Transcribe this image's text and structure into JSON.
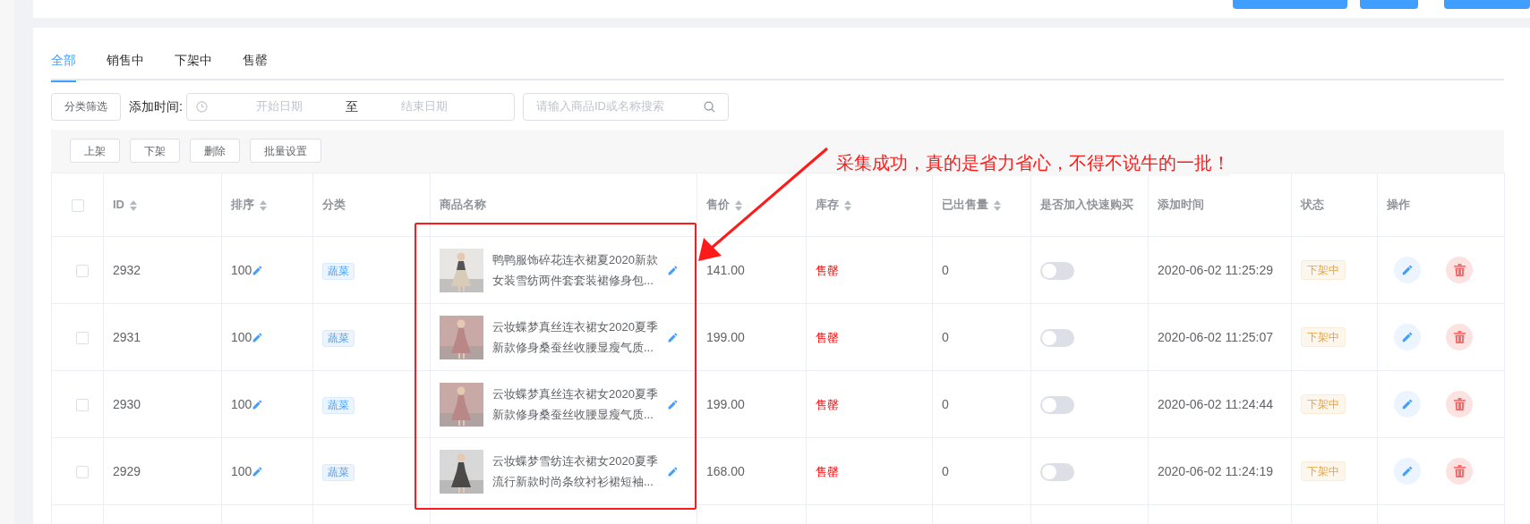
{
  "tabs": [
    {
      "label": "全部",
      "selected": true
    },
    {
      "label": "销售中",
      "selected": false
    },
    {
      "label": "下架中",
      "selected": false
    },
    {
      "label": "售罄",
      "selected": false
    }
  ],
  "filter": {
    "category_button": "分类筛选",
    "date_label": "添加时间:",
    "start_placeholder": "开始日期",
    "separator": "至",
    "end_placeholder": "结束日期",
    "search_placeholder": "请输入商品ID或名称搜索"
  },
  "toolbar": [
    "上架",
    "下架",
    "删除",
    "批量设置"
  ],
  "table": {
    "all_checked": false,
    "columns": [
      {
        "label": "ID",
        "sortable": true
      },
      {
        "label": "排序",
        "sortable": true
      },
      {
        "label": "分类",
        "sortable": false
      },
      {
        "label": "商品名称",
        "sortable": false
      },
      {
        "label": "售价",
        "sortable": true
      },
      {
        "label": "库存",
        "sortable": true
      },
      {
        "label": "已出售量",
        "sortable": true
      },
      {
        "label": "是否加入快速购买",
        "sortable": false
      },
      {
        "label": "添加时间",
        "sortable": false
      },
      {
        "label": "状态",
        "sortable": false
      },
      {
        "label": "操作",
        "sortable": false
      }
    ],
    "rows": [
      {
        "checked": false,
        "id": "2932",
        "sort": "100",
        "category": "蔬菜",
        "name": "鸭鸭服饰碎花连衣裙夏2020新款女装雪纺两件套套装裙修身包...",
        "price": "141.00",
        "stock": "售罄",
        "sold": "0",
        "quick_buy": false,
        "added": "2020-06-02 11:25:29",
        "status": "下架中"
      },
      {
        "checked": false,
        "id": "2931",
        "sort": "100",
        "category": "蔬菜",
        "name": "云妆蝶梦真丝连衣裙女2020夏季新款修身桑蚕丝收腰显瘦气质...",
        "price": "199.00",
        "stock": "售罄",
        "sold": "0",
        "quick_buy": false,
        "added": "2020-06-02 11:25:07",
        "status": "下架中"
      },
      {
        "checked": false,
        "id": "2930",
        "sort": "100",
        "category": "蔬菜",
        "name": "云妆蝶梦真丝连衣裙女2020夏季新款修身桑蚕丝收腰显瘦气质...",
        "price": "199.00",
        "stock": "售罄",
        "sold": "0",
        "quick_buy": false,
        "added": "2020-06-02 11:24:44",
        "status": "下架中"
      },
      {
        "checked": false,
        "id": "2929",
        "sort": "100",
        "category": "蔬菜",
        "name": "云妆蝶梦雪纺连衣裙女2020夏季流行新款时尚条纹衬衫裙短袖...",
        "price": "168.00",
        "stock": "售罄",
        "sold": "0",
        "quick_buy": false,
        "added": "2020-06-02 11:24:19",
        "status": "下架中"
      }
    ]
  },
  "annotation": {
    "text": "采集成功，真的是省力省心，不得不说牛的一批！"
  }
}
